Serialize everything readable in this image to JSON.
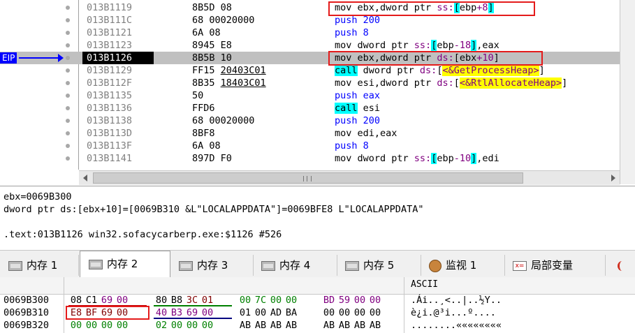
{
  "eip_label": "EIP",
  "disasm": [
    {
      "addr": "013B1119",
      "bytes": "8B5D 08",
      "ins": "mov ebx,dword ptr ss:[ebp+8]"
    },
    {
      "addr": "013B111C",
      "bytes": "68 00020000",
      "ins": "push 200"
    },
    {
      "addr": "013B1121",
      "bytes": "6A 08",
      "ins": "push 8"
    },
    {
      "addr": "013B1123",
      "bytes": "8945 E8",
      "ins": "mov dword ptr ss:[ebp-18],eax"
    },
    {
      "addr": "013B1126",
      "bytes": "8B5B 10",
      "ins": "mov ebx,dword ptr ds:[ebx+10]"
    },
    {
      "addr": "013B1129",
      "bytes": "FF15 20403C01",
      "ins": "call dword ptr ds:[<&GetProcessHeap>]"
    },
    {
      "addr": "013B112F",
      "bytes": "8B35 18403C01",
      "ins": "mov esi,dword ptr ds:[<&RtlAllocateHeap>]"
    },
    {
      "addr": "013B1135",
      "bytes": "50",
      "ins": "push eax"
    },
    {
      "addr": "013B1136",
      "bytes": "FFD6",
      "ins": "call esi"
    },
    {
      "addr": "013B1138",
      "bytes": "68 00020000",
      "ins": "push 200"
    },
    {
      "addr": "013B113D",
      "bytes": "8BF8",
      "ins": "mov edi,eax"
    },
    {
      "addr": "013B113F",
      "bytes": "6A 08",
      "ins": "push 8"
    },
    {
      "addr": "013B1141",
      "bytes": "897D F0",
      "ins": "mov dword ptr ss:[ebp-10],edi"
    }
  ],
  "info": {
    "line1": "ebx=0069B300",
    "line2": "dword ptr ds:[ebx+10]=[0069B310 &L\"LOCALAPPDATA\"]=0069BFE8 L\"LOCALAPPDATA\"",
    "line3": ".text:013B1126 win32.sofacycarberp.exe:$1126 #526"
  },
  "tabs": [
    {
      "label": "内存 1",
      "icon": "memory-icon"
    },
    {
      "label": "内存 2",
      "icon": "memory-icon"
    },
    {
      "label": "内存 3",
      "icon": "memory-icon"
    },
    {
      "label": "内存 4",
      "icon": "memory-icon"
    },
    {
      "label": "内存 5",
      "icon": "memory-icon"
    },
    {
      "label": "监视 1",
      "icon": "watch-icon"
    },
    {
      "label": "局部变量",
      "icon": "locals-icon"
    }
  ],
  "hex": {
    "ascii_header": "ASCII",
    "rows": [
      {
        "addr": "0069B300",
        "bytes": [
          "08",
          "C1",
          "69",
          "00",
          "80",
          "B8",
          "3C",
          "01",
          "00",
          "7C",
          "00",
          "00",
          "BD",
          "59",
          "00",
          "00"
        ],
        "ascii": ".Ái..¸<..|..½Y.."
      },
      {
        "addr": "0069B310",
        "bytes": [
          "E8",
          "BF",
          "69",
          "00",
          "40",
          "B3",
          "69",
          "00",
          "01",
          "00",
          "AD",
          "BA",
          "00",
          "00",
          "00",
          "00"
        ],
        "ascii": "è¿i.@³i...­º...."
      },
      {
        "addr": "0069B320",
        "bytes": [
          "00",
          "00",
          "00",
          "00",
          "02",
          "00",
          "00",
          "00",
          "AB",
          "AB",
          "AB",
          "AB",
          "AB",
          "AB",
          "AB",
          "AB"
        ],
        "ascii": "........««««««««"
      }
    ]
  },
  "colors": {
    "eip": "#0000ff",
    "highlight_row": "#c0c0c0",
    "call_bg": "#00ffff",
    "symbol_bg": "#ffff00",
    "red_box": "#e41b1b"
  }
}
